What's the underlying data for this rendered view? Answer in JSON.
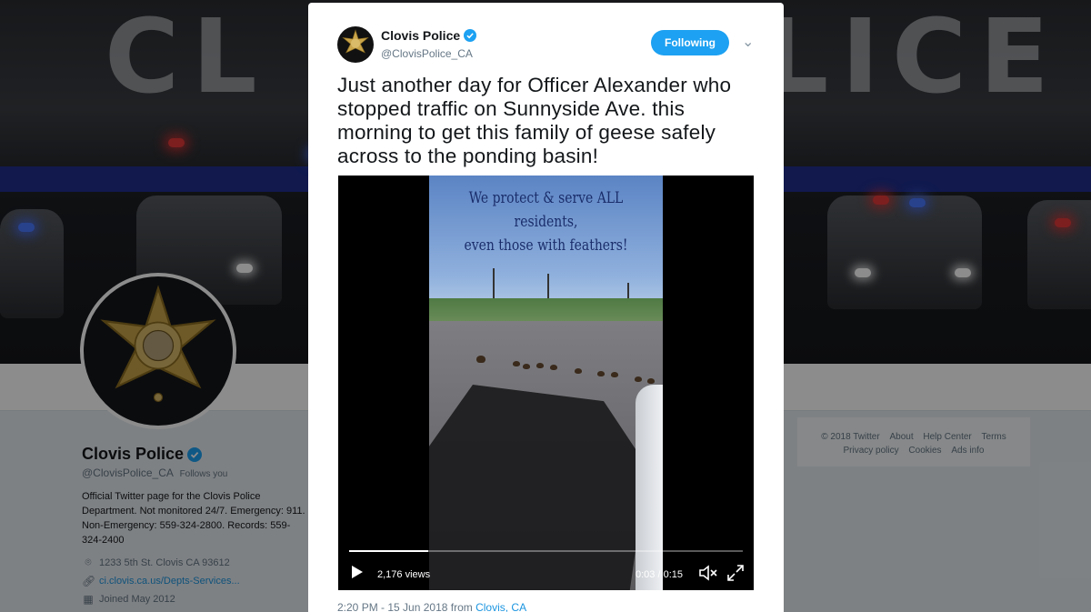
{
  "banner": {
    "left_word": "CL",
    "right_word": "LICE"
  },
  "profile": {
    "name": "Clovis Police",
    "handle": "@ClovisPolice_CA",
    "follows_you": "Follows you",
    "bio": "Official Twitter page for the Clovis Police Department. Not monitored 24/7. Emergency: 911. Non-Emergency: 559-324-2800. Records: 559-324-2400",
    "location": "1233 5th St. Clovis CA 93612",
    "website": "ci.clovis.ca.us/Depts-Services...",
    "joined": "Joined May 2012",
    "icons": {
      "location": "location-pin-icon",
      "link": "link-icon",
      "calendar": "calendar-icon"
    }
  },
  "footer": {
    "row1": [
      "© 2018 Twitter",
      "About",
      "Help Center",
      "Terms"
    ],
    "row2": [
      "Privacy policy",
      "Cookies",
      "Ads info"
    ]
  },
  "tweet": {
    "author_name": "Clovis Police",
    "author_handle": "@ClovisPolice_CA",
    "follow_label": "Following",
    "text": "Just another day for Officer Alexander who stopped traffic on Sunnyside Ave. this morning to get this family of geese safely across to the ponding basin!",
    "video": {
      "caption_line1": "We protect & serve ALL residents,",
      "caption_line2": "even those with feathers!",
      "views": "2,176 views",
      "time": "0:03 / 0:15",
      "progress": 0.2
    },
    "timestamp": "2:20 PM - 15 Jun 2018 from",
    "location": "Clovis, CA"
  },
  "colors": {
    "accent": "#1da1f2",
    "link": "#1b95e0",
    "verified": "#1da1f2"
  }
}
